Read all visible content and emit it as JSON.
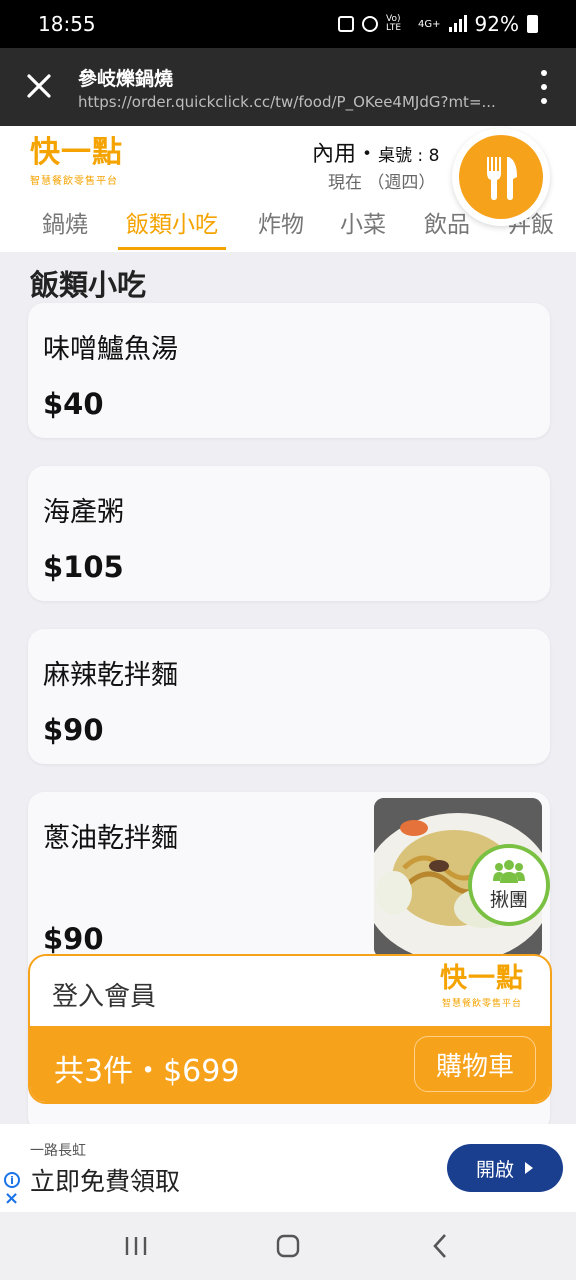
{
  "status_bar": {
    "time": "18:55",
    "network": "Vo) LTE",
    "network2": "4G+",
    "battery": "92%"
  },
  "browser": {
    "title": "參岐爍鍋燒",
    "url": "https://order.quickclick.cc/tw/food/P_OKee4MJdG?mt=..."
  },
  "app": {
    "logo_main": "快一點",
    "logo_sub": "智慧餐飲零售平台",
    "dining_mode": "內用",
    "table_label": "桌號 : 8",
    "time_label": "現在 （週四）"
  },
  "tabs": [
    {
      "label": "鍋燒"
    },
    {
      "label": "飯類小吃"
    },
    {
      "label": "炸物"
    },
    {
      "label": "小菜"
    },
    {
      "label": "飲品"
    },
    {
      "label": "丼飯"
    }
  ],
  "section": {
    "title": "飯類小吃"
  },
  "menu_items": [
    {
      "name": "味噌鱸魚湯",
      "price": "$40"
    },
    {
      "name": "海產粥",
      "price": "$105"
    },
    {
      "name": "麻辣乾拌麵",
      "price": "$90"
    },
    {
      "name": "蔥油乾拌麵",
      "price": "$90"
    }
  ],
  "group_order": {
    "label": "揪團"
  },
  "cart": {
    "login_label": "登入會員",
    "summary": "共3件・$699",
    "button_label": "購物車"
  },
  "ad": {
    "brand": "一路長虹",
    "text": "立即免費領取",
    "button_label": "開啟"
  },
  "colors": {
    "accent": "#f7a21b",
    "ad_button": "#1a3f8f",
    "group_ring": "#7ac143"
  }
}
